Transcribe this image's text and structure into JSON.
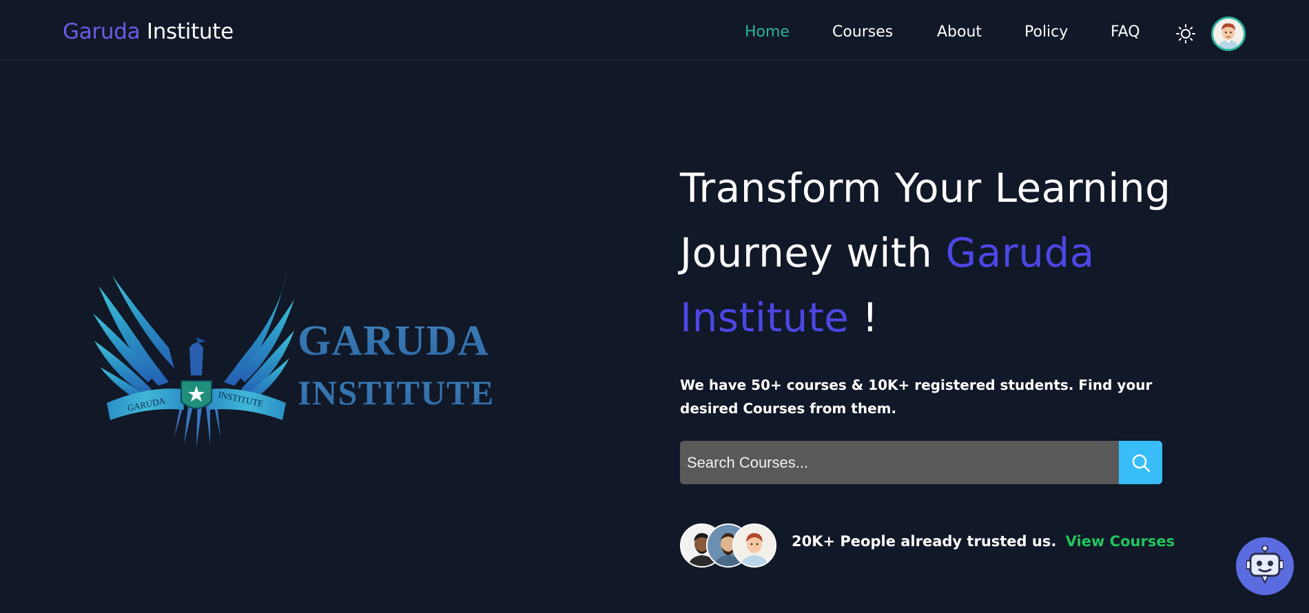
{
  "brand": {
    "part1": "Garuda",
    "part2": "Institute"
  },
  "nav": {
    "items": [
      {
        "label": "Home",
        "active": true
      },
      {
        "label": "Courses",
        "active": false
      },
      {
        "label": "About",
        "active": false
      },
      {
        "label": "Policy",
        "active": false
      },
      {
        "label": "FAQ",
        "active": false
      }
    ],
    "theme_icon": "sun-icon",
    "avatar_icon": "user-avatar"
  },
  "logo": {
    "line1": "GARUDA",
    "line2": "INSTITUTE",
    "ribbon_left": "GARUDA",
    "ribbon_right": "INSTITUTE"
  },
  "hero": {
    "title_part1": "Transform Your Learning",
    "title_part2": "Journey with ",
    "title_highlight1": "Garuda",
    "title_highlight2": "Institute",
    "title_end": " !",
    "description": "We have 50+ courses & 10K+ registered students. Find your desired Courses from them.",
    "search_placeholder": "Search Courses...",
    "trust_text": "20K+ People already trusted us.",
    "trust_link": "View Courses"
  },
  "colors": {
    "background": "#111827",
    "brand_accent": "#6d5ce8",
    "title_accent": "#4f46e5",
    "nav_active": "#2bb3a0",
    "search_button": "#38bdf8",
    "link_green": "#22c55e",
    "chatbot": "#5b6be0"
  },
  "icons": {
    "search": "search-icon",
    "chatbot": "robot-icon"
  }
}
